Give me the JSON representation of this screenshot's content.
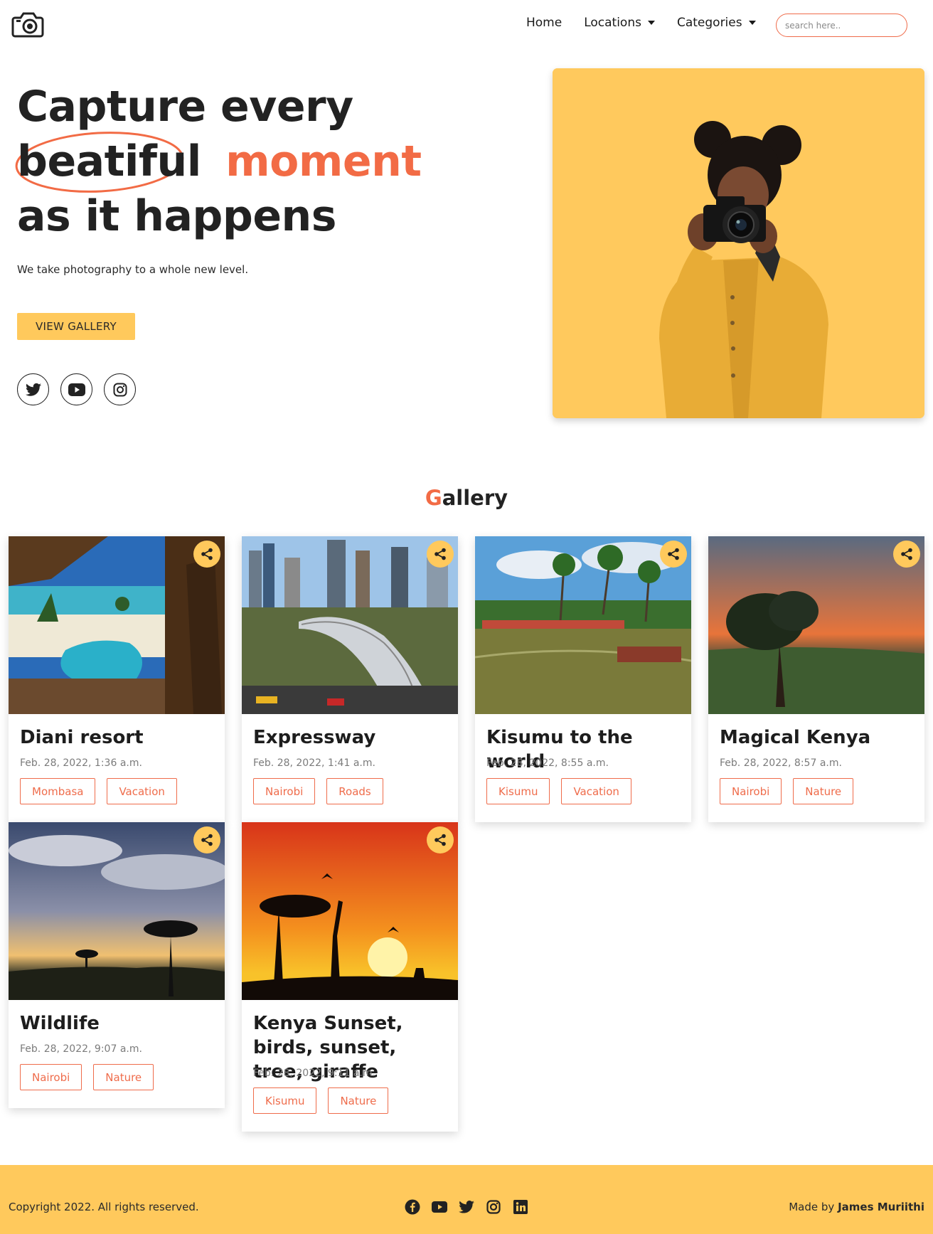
{
  "nav": {
    "logo_icon": "camera-icon",
    "links": {
      "home": "Home",
      "locations": "Locations",
      "categories": "Categories"
    },
    "search_placeholder": "search here.."
  },
  "hero": {
    "title_line1": "Capture every",
    "title_word_circled": "beatiful",
    "title_word_accent": "moment",
    "title_line3": "as it happens",
    "subtitle": "We take photography to a whole new level.",
    "button_label": "VIEW GALLERY",
    "socials": [
      "twitter-icon",
      "youtube-icon",
      "instagram-icon"
    ]
  },
  "gallery": {
    "title_first_letter": "G",
    "title_rest": "allery",
    "cards": [
      {
        "title": "Diani resort",
        "date": "Feb. 28, 2022, 1:36 a.m.",
        "tags": [
          "Mombasa",
          "Vacation"
        ]
      },
      {
        "title": "Expressway",
        "date": "Feb. 28, 2022, 1:41 a.m.",
        "tags": [
          "Nairobi",
          "Roads"
        ]
      },
      {
        "title": "Kisumu to the world",
        "date": "Feb. 28, 2022, 8:55 a.m.",
        "tags": [
          "Kisumu",
          "Vacation"
        ]
      },
      {
        "title": "Magical Kenya",
        "date": "Feb. 28, 2022, 8:57 a.m.",
        "tags": [
          "Nairobi",
          "Nature"
        ]
      },
      {
        "title": "Wildlife",
        "date": "Feb. 28, 2022, 9:07 a.m.",
        "tags": [
          "Nairobi",
          "Nature"
        ]
      },
      {
        "title": "Kenya Sunset, birds, sunset, tree, giraffe",
        "date": "Feb. 28, 2022, 9:11 a.m.",
        "tags": [
          "Kisumu",
          "Nature"
        ]
      }
    ]
  },
  "footer": {
    "copyright": "Copyright 2022. All rights reserved.",
    "made_by_prefix": "Made by",
    "made_by_name": "James Muriithi",
    "socials": [
      "facebook-icon",
      "youtube-icon",
      "twitter-icon",
      "instagram-icon",
      "linkedin-icon"
    ]
  },
  "colors": {
    "accent": "#f26b45",
    "yellow": "#ffc95c"
  }
}
